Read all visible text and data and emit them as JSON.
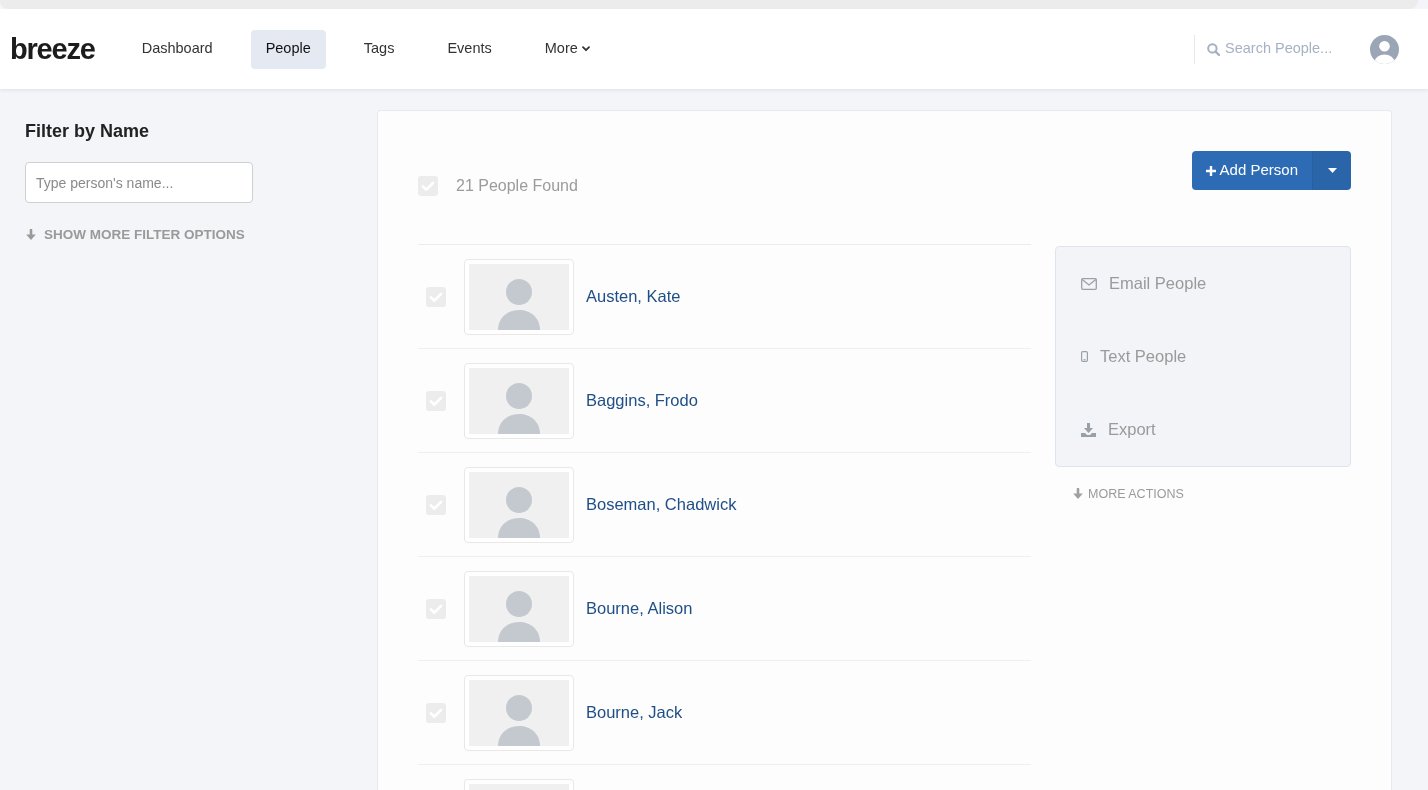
{
  "logo": "breeze",
  "nav": {
    "items": [
      {
        "label": "Dashboard",
        "selected": false,
        "kind": "link"
      },
      {
        "label": "People",
        "selected": true,
        "kind": "link"
      },
      {
        "label": "Tags",
        "selected": false,
        "kind": "link"
      },
      {
        "label": "Events",
        "selected": false,
        "kind": "link"
      },
      {
        "label": "More",
        "selected": false,
        "kind": "dropdown"
      }
    ],
    "search": {
      "placeholder": "Search People..."
    }
  },
  "filter": {
    "title": "Filter by Name",
    "input": {
      "placeholder": "Type person's name..."
    },
    "more_link": "SHOW MORE FILTER OPTIONS"
  },
  "results": {
    "select_all": {
      "checked": false
    },
    "count_label": "21 People Found",
    "add_button": "Add Person"
  },
  "people": [
    {
      "name": "Austen, Kate",
      "checked": false
    },
    {
      "name": "Baggins, Frodo",
      "checked": false
    },
    {
      "name": "Boseman, Chadwick",
      "checked": false
    },
    {
      "name": "Bourne, Alison",
      "checked": false
    },
    {
      "name": "Bourne, Jack",
      "checked": false
    }
  ],
  "cut_off_row": true,
  "actions": [
    {
      "kind": "email",
      "label": "Email People"
    },
    {
      "kind": "text",
      "label": "Text People"
    },
    {
      "kind": "export",
      "label": "Export"
    }
  ],
  "more_actions": "MORE ACTIONS"
}
